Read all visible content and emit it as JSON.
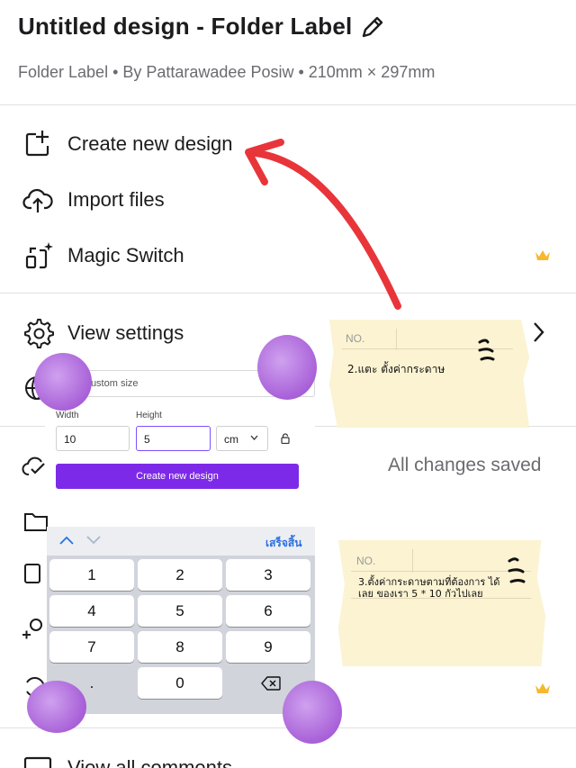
{
  "header": {
    "title": "Untitled design - Folder Label",
    "subtitle": "Folder Label • By Pattarawadee Posiw • 210mm × 297mm"
  },
  "menu": {
    "items": [
      {
        "label": "Create new design",
        "icon": "plus-square-icon"
      },
      {
        "label": "Import files",
        "icon": "cloud-upload-icon"
      },
      {
        "label": "Magic Switch",
        "icon": "magic-switch-icon",
        "badge": "crown-icon"
      },
      {
        "label": "View settings",
        "icon": "gear-icon"
      },
      {
        "label": "View all comments",
        "icon": "comment-icon"
      }
    ],
    "saved_status": "All changes saved"
  },
  "notes": [
    {
      "label": "NO.",
      "text": "2.แตะ ตั้งค่ากระดาษ"
    },
    {
      "label": "NO.",
      "text": "3.ตั้งค่ากระดาษตามที่ต้องการ ได้เลย ของเรา 5 * 10 กัวไปเลย"
    }
  ],
  "custom_size": {
    "placeholder": "Custom size",
    "width_label": "Width",
    "height_label": "Height",
    "width_value": "10",
    "height_value": "5",
    "unit": "cm",
    "button": "Create new design"
  },
  "keyboard": {
    "done": "เสร็จสิ้น",
    "keys": [
      "1",
      "2",
      "3",
      "4",
      "5",
      "6",
      "7",
      "8",
      "9",
      ".",
      "0"
    ]
  },
  "colors": {
    "accent_purple": "#7d2ae8",
    "arrow_red": "#e8353a",
    "note_paper": "#fbf3d2",
    "crown_gold": "#f5b82e",
    "purple_blob": "#b06be0"
  }
}
